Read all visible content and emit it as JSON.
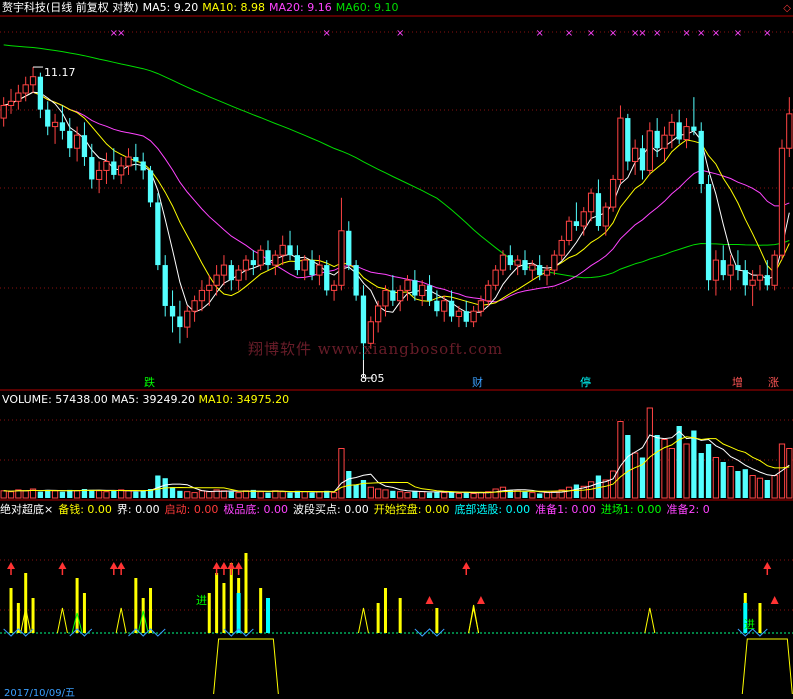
{
  "header": {
    "title": "赘宇科技(日线 前复权 对数)",
    "ma5": "MA5: 9.20",
    "ma10": "MA10: 8.98",
    "ma20": "MA20: 9.16",
    "ma60": "MA60: 9.10",
    "colors": {
      "title": "#ffffff",
      "ma5": "#ffffff",
      "ma10": "#ffff00",
      "ma20": "#ff44ff",
      "ma60": "#00dd00"
    }
  },
  "annotations": {
    "high_label": "11.17",
    "low_label": "8.05"
  },
  "watermark": "翔博软件 www.xiangbosoft.com",
  "events": [
    {
      "text": "跌",
      "color": "#00ff00"
    },
    {
      "text": "财",
      "color": "#3aa0ff"
    },
    {
      "text": "停",
      "color": "#00ffff"
    },
    {
      "text": "增",
      "color": "#ff5555"
    },
    {
      "text": "涨",
      "color": "#ff5555"
    }
  ],
  "volume_header": {
    "volume": "VOLUME: 57438.00",
    "ma5": "MA5: 39249.20",
    "ma10": "MA10: 34975.20"
  },
  "indicator_header": {
    "name": "绝对超底×",
    "items": [
      {
        "text": "备钱: 0.00",
        "color": "#ffff00"
      },
      {
        "text": "界: 0.00",
        "color": "#ffffff"
      },
      {
        "text": "启动: 0.00",
        "color": "#ff3a3a"
      },
      {
        "text": "极品底: 0.00",
        "color": "#ff44ff"
      },
      {
        "text": "波段买点: 0.00",
        "color": "#ffffff"
      },
      {
        "text": "开始控盘: 0.00",
        "color": "#ffff00"
      },
      {
        "text": "底部选股: 0.00",
        "color": "#00ffff"
      },
      {
        "text": "准备1: 0.00",
        "color": "#ff44ff"
      },
      {
        "text": "进场1: 0.00",
        "color": "#00ff00"
      },
      {
        "text": "准备2: 0",
        "color": "#ff44ff"
      }
    ]
  },
  "indicator_labels": {
    "jin": "进"
  },
  "date_label": "2017/10/09/五",
  "chart_data": {
    "type": "candlestick",
    "ylim": [
      7.8,
      11.8
    ],
    "log_scale": true,
    "grid": "dotted horizontal",
    "candles": [
      [
        10.55,
        10.8,
        10.45,
        10.7
      ],
      [
        10.7,
        10.9,
        10.6,
        10.75
      ],
      [
        10.75,
        10.95,
        10.65,
        10.85
      ],
      [
        10.85,
        11.05,
        10.75,
        10.95
      ],
      [
        10.95,
        11.17,
        10.85,
        11.05
      ],
      [
        11.05,
        11.1,
        10.55,
        10.65
      ],
      [
        10.65,
        10.75,
        10.35,
        10.45
      ],
      [
        10.45,
        10.6,
        10.25,
        10.5
      ],
      [
        10.5,
        10.7,
        10.3,
        10.4
      ],
      [
        10.4,
        10.55,
        10.1,
        10.2
      ],
      [
        10.2,
        10.45,
        10.05,
        10.35
      ],
      [
        10.35,
        10.5,
        10.0,
        10.1
      ],
      [
        10.1,
        10.25,
        9.75,
        9.85
      ],
      [
        9.85,
        10.05,
        9.7,
        9.95
      ],
      [
        9.95,
        10.15,
        9.8,
        10.05
      ],
      [
        10.05,
        10.2,
        9.85,
        9.9
      ],
      [
        9.9,
        10.1,
        9.8,
        10.0
      ],
      [
        10.0,
        10.2,
        9.9,
        10.1
      ],
      [
        10.1,
        10.25,
        9.95,
        10.05
      ],
      [
        10.05,
        10.15,
        9.85,
        9.95
      ],
      [
        9.95,
        10.0,
        9.55,
        9.6
      ],
      [
        9.6,
        9.7,
        8.9,
        8.95
      ],
      [
        8.95,
        9.05,
        8.45,
        8.55
      ],
      [
        8.55,
        8.7,
        8.3,
        8.45
      ],
      [
        8.45,
        8.6,
        8.2,
        8.35
      ],
      [
        8.35,
        8.55,
        8.25,
        8.5
      ],
      [
        8.5,
        8.65,
        8.4,
        8.6
      ],
      [
        8.6,
        8.8,
        8.5,
        8.7
      ],
      [
        8.7,
        8.85,
        8.55,
        8.75
      ],
      [
        8.75,
        8.95,
        8.65,
        8.85
      ],
      [
        8.85,
        9.05,
        8.75,
        8.95
      ],
      [
        8.95,
        9.0,
        8.7,
        8.8
      ],
      [
        8.8,
        8.95,
        8.7,
        8.9
      ],
      [
        8.9,
        9.05,
        8.8,
        9.0
      ],
      [
        9.0,
        9.1,
        8.85,
        8.95
      ],
      [
        8.95,
        9.15,
        8.9,
        9.1
      ],
      [
        9.1,
        9.2,
        8.9,
        8.95
      ],
      [
        8.95,
        9.1,
        8.85,
        9.05
      ],
      [
        9.05,
        9.25,
        8.95,
        9.15
      ],
      [
        9.15,
        9.3,
        9.0,
        9.05
      ],
      [
        9.05,
        9.15,
        8.85,
        8.9
      ],
      [
        8.9,
        9.05,
        8.8,
        9.0
      ],
      [
        9.0,
        9.1,
        8.8,
        8.85
      ],
      [
        8.85,
        9.05,
        8.75,
        8.95
      ],
      [
        8.95,
        9.0,
        8.65,
        8.7
      ],
      [
        8.7,
        8.8,
        8.6,
        8.75
      ],
      [
        8.75,
        9.65,
        8.7,
        9.3
      ],
      [
        9.3,
        9.4,
        8.9,
        8.95
      ],
      [
        8.95,
        9.0,
        8.6,
        8.65
      ],
      [
        8.65,
        8.75,
        8.05,
        8.2
      ],
      [
        8.2,
        8.45,
        8.15,
        8.4
      ],
      [
        8.4,
        8.6,
        8.3,
        8.55
      ],
      [
        8.55,
        8.75,
        8.45,
        8.7
      ],
      [
        8.7,
        8.85,
        8.55,
        8.6
      ],
      [
        8.6,
        8.75,
        8.5,
        8.7
      ],
      [
        8.7,
        8.85,
        8.6,
        8.8
      ],
      [
        8.8,
        8.9,
        8.6,
        8.65
      ],
      [
        8.65,
        8.8,
        8.55,
        8.75
      ],
      [
        8.75,
        8.85,
        8.55,
        8.6
      ],
      [
        8.6,
        8.7,
        8.45,
        8.5
      ],
      [
        8.5,
        8.65,
        8.4,
        8.6
      ],
      [
        8.6,
        8.7,
        8.4,
        8.45
      ],
      [
        8.45,
        8.55,
        8.35,
        8.5
      ],
      [
        8.5,
        8.6,
        8.35,
        8.4
      ],
      [
        8.4,
        8.55,
        8.35,
        8.5
      ],
      [
        8.5,
        8.65,
        8.45,
        8.6
      ],
      [
        8.6,
        8.8,
        8.55,
        8.75
      ],
      [
        8.75,
        8.95,
        8.7,
        8.9
      ],
      [
        8.9,
        9.1,
        8.85,
        9.05
      ],
      [
        9.05,
        9.15,
        8.9,
        8.95
      ],
      [
        8.95,
        9.05,
        8.85,
        9.0
      ],
      [
        9.0,
        9.1,
        8.85,
        8.9
      ],
      [
        8.9,
        9.0,
        8.8,
        8.95
      ],
      [
        8.95,
        9.05,
        8.8,
        8.85
      ],
      [
        8.85,
        8.95,
        8.75,
        8.9
      ],
      [
        8.9,
        9.1,
        8.85,
        9.05
      ],
      [
        9.05,
        9.25,
        9.0,
        9.2
      ],
      [
        9.2,
        9.45,
        9.15,
        9.4
      ],
      [
        9.4,
        9.6,
        9.3,
        9.35
      ],
      [
        9.35,
        9.55,
        9.25,
        9.5
      ],
      [
        9.5,
        9.75,
        9.4,
        9.7
      ],
      [
        9.7,
        9.85,
        9.3,
        9.35
      ],
      [
        9.35,
        9.6,
        9.25,
        9.55
      ],
      [
        9.55,
        9.9,
        9.5,
        9.85
      ],
      [
        9.85,
        10.7,
        9.8,
        10.55
      ],
      [
        10.55,
        10.6,
        9.95,
        10.05
      ],
      [
        10.05,
        10.3,
        9.9,
        10.2
      ],
      [
        10.2,
        10.35,
        9.85,
        9.95
      ],
      [
        9.95,
        10.5,
        9.9,
        10.4
      ],
      [
        10.4,
        10.55,
        10.1,
        10.2
      ],
      [
        10.2,
        10.45,
        10.05,
        10.35
      ],
      [
        10.35,
        10.6,
        10.2,
        10.5
      ],
      [
        10.5,
        10.65,
        10.25,
        10.3
      ],
      [
        10.3,
        10.55,
        10.2,
        10.45
      ],
      [
        10.45,
        10.8,
        10.35,
        10.4
      ],
      [
        10.4,
        10.5,
        9.7,
        9.8
      ],
      [
        9.8,
        9.9,
        8.7,
        8.8
      ],
      [
        8.8,
        9.1,
        8.65,
        9.0
      ],
      [
        9.0,
        9.15,
        8.8,
        8.85
      ],
      [
        8.85,
        9.05,
        8.7,
        8.95
      ],
      [
        8.95,
        9.1,
        8.8,
        8.9
      ],
      [
        8.9,
        9.0,
        8.65,
        8.75
      ],
      [
        8.75,
        8.9,
        8.55,
        8.8
      ],
      [
        8.8,
        8.95,
        8.7,
        8.85
      ],
      [
        8.85,
        9.0,
        8.7,
        8.75
      ],
      [
        8.75,
        9.1,
        8.7,
        9.05
      ],
      [
        9.05,
        10.3,
        9.0,
        10.2
      ],
      [
        10.2,
        10.8,
        10.1,
        10.6
      ]
    ],
    "volume_ratio": [
      0.08,
      0.07,
      0.09,
      0.08,
      0.1,
      0.07,
      0.09,
      0.08,
      0.07,
      0.09,
      0.08,
      0.1,
      0.09,
      0.08,
      0.07,
      0.08,
      0.09,
      0.08,
      0.07,
      0.08,
      0.1,
      0.25,
      0.22,
      0.12,
      0.08,
      0.07,
      0.06,
      0.08,
      0.07,
      0.09,
      0.08,
      0.07,
      0.06,
      0.08,
      0.09,
      0.07,
      0.06,
      0.08,
      0.07,
      0.06,
      0.08,
      0.07,
      0.06,
      0.07,
      0.08,
      0.06,
      0.55,
      0.3,
      0.15,
      0.2,
      0.12,
      0.1,
      0.09,
      0.08,
      0.07,
      0.06,
      0.08,
      0.07,
      0.06,
      0.07,
      0.06,
      0.07,
      0.05,
      0.06,
      0.05,
      0.06,
      0.07,
      0.1,
      0.12,
      0.09,
      0.08,
      0.07,
      0.06,
      0.05,
      0.06,
      0.07,
      0.09,
      0.12,
      0.15,
      0.13,
      0.18,
      0.25,
      0.2,
      0.3,
      0.85,
      0.7,
      0.5,
      0.45,
      1.0,
      0.7,
      0.65,
      0.55,
      0.8,
      0.6,
      0.75,
      0.5,
      0.6,
      0.45,
      0.4,
      0.35,
      0.3,
      0.32,
      0.25,
      0.22,
      0.2,
      0.25,
      0.6,
      0.55
    ]
  }
}
